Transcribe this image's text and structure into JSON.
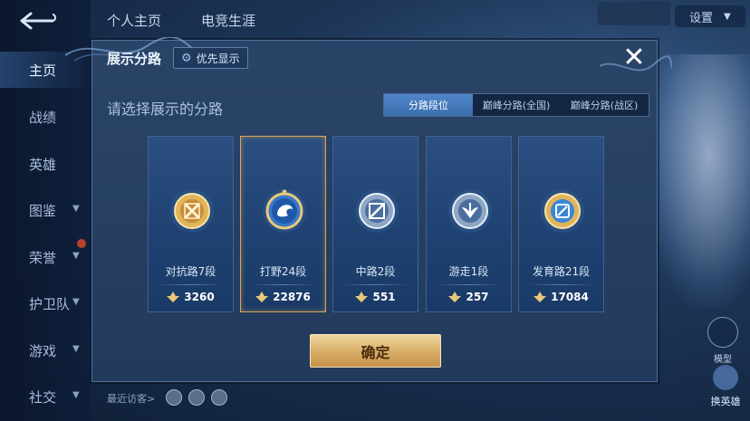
{
  "nav": {
    "items": [
      {
        "label": "主页",
        "chevron": false
      },
      {
        "label": "战绩",
        "chevron": false
      },
      {
        "label": "英雄",
        "chevron": false
      },
      {
        "label": "图鉴",
        "chevron": true
      },
      {
        "label": "荣誉",
        "chevron": true
      },
      {
        "label": "护卫队",
        "chevron": true
      },
      {
        "label": "游戏",
        "chevron": true
      },
      {
        "label": "社交",
        "chevron": true
      }
    ]
  },
  "top_tabs": [
    "个人主页",
    "电竞生涯"
  ],
  "settings_label": "设置",
  "visitors_label": "最近访客>",
  "model_label": "模型",
  "swap_hero_label": "换英雄",
  "modal": {
    "title": "展示分路",
    "priority_label": "优先显示",
    "close_label": "✕",
    "subtitle": "请选择展示的分路",
    "tabs": [
      {
        "label": "分路段位",
        "active": true
      },
      {
        "label": "巅峰分路(全国)",
        "active": false
      },
      {
        "label": "巅峰分路(战区)",
        "active": false
      }
    ],
    "cards": [
      {
        "label": "对抗路7段",
        "score": "3260",
        "selected": false,
        "emblem": "clash-lane-icon"
      },
      {
        "label": "打野24段",
        "score": "22876",
        "selected": true,
        "emblem": "jungle-dragon-icon"
      },
      {
        "label": "中路2段",
        "score": "551",
        "selected": false,
        "emblem": "mid-lane-icon"
      },
      {
        "label": "游走1段",
        "score": "257",
        "selected": false,
        "emblem": "roam-wings-icon"
      },
      {
        "label": "发育路21段",
        "score": "17084",
        "selected": false,
        "emblem": "farm-lane-icon"
      }
    ],
    "confirm_label": "确定"
  },
  "colors": {
    "accent_gold": "#d9b06a",
    "active_tab": "#4f86c9",
    "card_bg": "#1f4272"
  }
}
